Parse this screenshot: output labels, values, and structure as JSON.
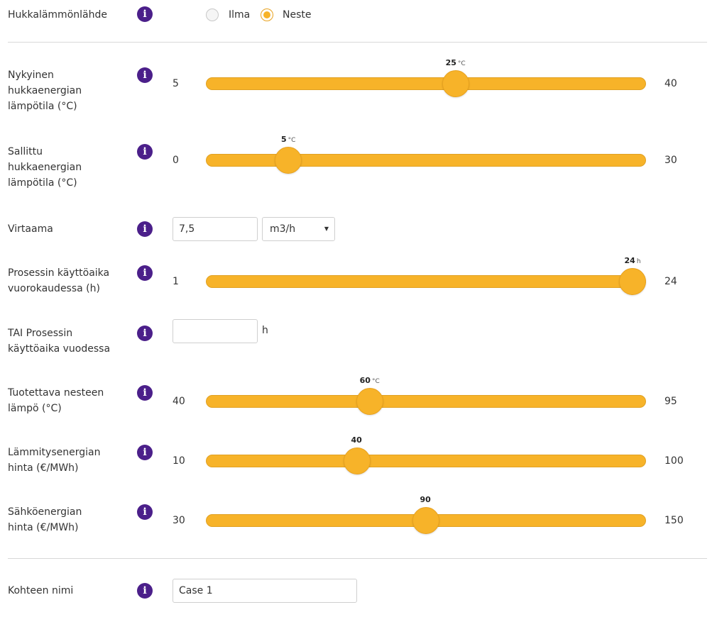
{
  "info_icon_glyph": "i",
  "source": {
    "label": "Hukkalämmönlähde",
    "options": [
      {
        "label": "Ilma",
        "checked": false
      },
      {
        "label": "Neste",
        "checked": true
      }
    ]
  },
  "sliders": [
    {
      "id": "current-temp",
      "label": [
        "Nykyinen",
        "hukkaenergian",
        "lämpötila (°C)"
      ],
      "min": 5,
      "max": 40,
      "value": 25,
      "value_text": "25",
      "unit": "°C"
    },
    {
      "id": "allowed-temp",
      "label": [
        "Sallittu",
        "hukkaenergian",
        "lämpötila (°C)"
      ],
      "min": 0,
      "max": 30,
      "value": 5,
      "value_text": "5",
      "unit": "°C"
    },
    {
      "id": "daily-hours",
      "label": [
        "Prosessin käyttöaika",
        "vuorokaudessa (h)"
      ],
      "min": 1,
      "max": 24,
      "value": 24,
      "value_text": "24",
      "unit": "h"
    },
    {
      "id": "fluid-heat",
      "label": [
        "Tuotettava nesteen",
        "lämpö (°C)"
      ],
      "min": 40,
      "max": 95,
      "value": 60,
      "value_text": "60",
      "unit": "°C"
    },
    {
      "id": "heating-price",
      "label": [
        "Lämmitysenergian",
        "hinta (€/MWh)"
      ],
      "min": 10,
      "max": 100,
      "value": 40,
      "value_text": "40",
      "unit": ""
    },
    {
      "id": "electricity-price",
      "label": [
        "Sähköenergian",
        "hinta (€/MWh)"
      ],
      "min": 30,
      "max": 150,
      "value": 90,
      "value_text": "90",
      "unit": ""
    }
  ],
  "flow": {
    "label": "Virtaama",
    "value": "7,5",
    "unit_selected": "m3/h",
    "caret": "▼"
  },
  "yearly": {
    "label": [
      "TAI Prosessin",
      "käyttöaika vuodessa"
    ],
    "value": "",
    "unit": "h"
  },
  "name": {
    "label": "Kohteen nimi",
    "value": "Case 1"
  },
  "colors": {
    "accent": "#f7b329",
    "info_icon": "#4b1f8a",
    "divider": "#d8d8d8"
  }
}
